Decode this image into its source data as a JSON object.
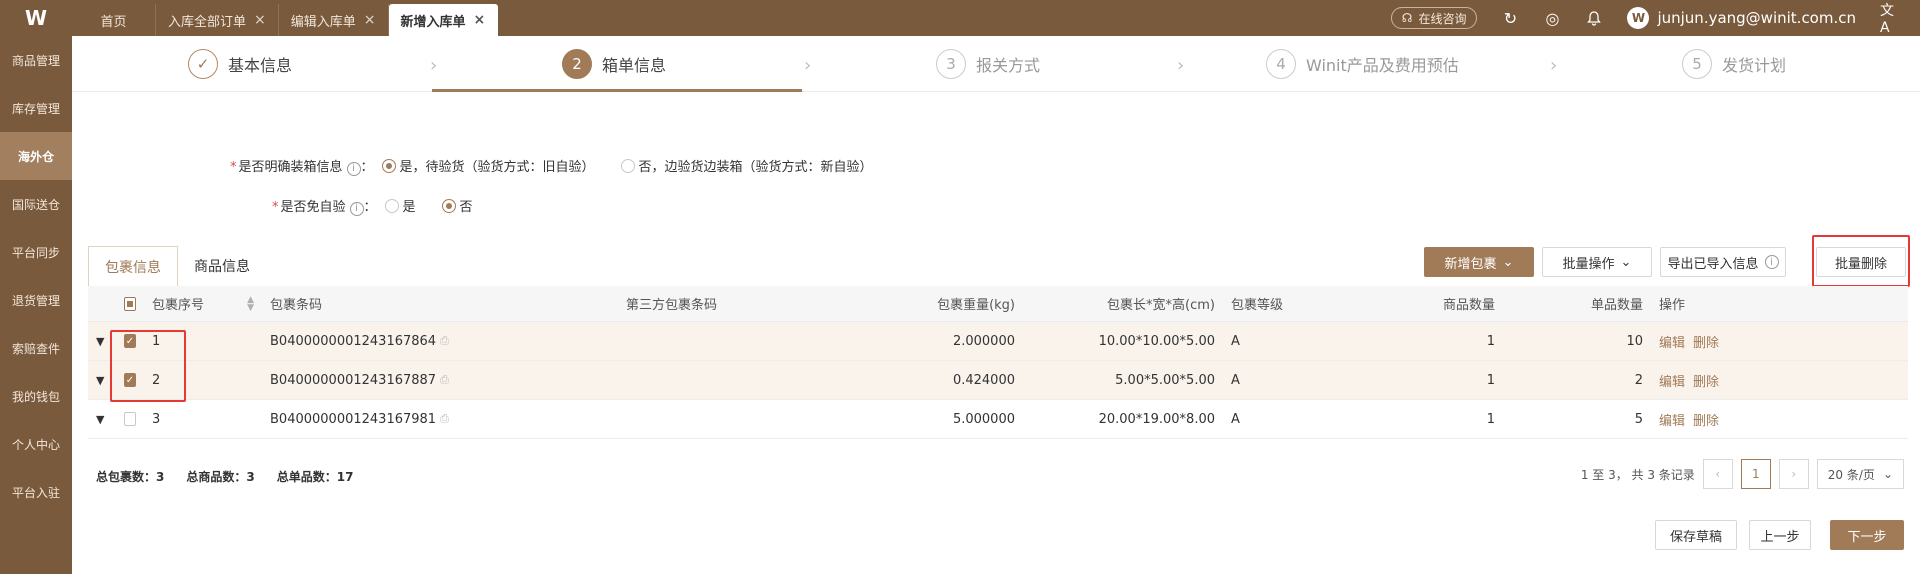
{
  "topbar": {
    "logo": "W",
    "tabs": [
      {
        "label": "首页",
        "closable": false
      },
      {
        "label": "入库全部订单",
        "closable": true
      },
      {
        "label": "编辑入库单",
        "closable": true
      },
      {
        "label": "新增入库单",
        "closable": true,
        "active": true
      }
    ],
    "consult_label": "在线咨询",
    "user_email": "junjun.yang@winit.com.cn"
  },
  "sidebar": {
    "items": [
      "商品管理",
      "库存管理",
      "海外仓",
      "国际送仓",
      "平台同步",
      "退货管理",
      "索赔查件",
      "我的钱包",
      "个人中心",
      "平台入驻"
    ],
    "active": "海外仓"
  },
  "stepper": {
    "steps": [
      {
        "num": "✓",
        "label": "基本信息"
      },
      {
        "num": "2",
        "label": "箱单信息"
      },
      {
        "num": "3",
        "label": "报关方式"
      },
      {
        "num": "4",
        "label": "Winit产品及费用预估"
      },
      {
        "num": "5",
        "label": "发货计划"
      }
    ]
  },
  "form": {
    "q1_label": "是否明确装箱信息",
    "q1_opt1": "是，待验货（验货方式：旧自验）",
    "q1_opt2": "否，边验货边装箱（验货方式：新自验）",
    "q2_label": "是否免自验",
    "q2_opt1": "是",
    "q2_opt2": "否"
  },
  "subtabs": [
    "包裹信息",
    "商品信息"
  ],
  "toolbar": {
    "add_package": "新增包裹",
    "batch_ops": "批量操作",
    "export_imported": "导出已导入信息",
    "batch_delete": "批量删除"
  },
  "table": {
    "headers": {
      "seq": "包裹序号",
      "barcode": "包裹条码",
      "third_barcode": "第三方包裹条码",
      "weight": "包裹重量(kg)",
      "dims": "包裹长*宽*高(cm)",
      "grade": "包裹等级",
      "goods_count": "商品数量",
      "unit_count": "单品数量",
      "ops": "操作"
    },
    "rows": [
      {
        "seq": "1",
        "barcode": "B0400000001243167864",
        "third": "",
        "weight": "2.000000",
        "dims": "10.00*10.00*5.00",
        "grade": "A",
        "goods": "1",
        "units": "10",
        "edit": "编辑",
        "del": "删除",
        "checked": true
      },
      {
        "seq": "2",
        "barcode": "B0400000001243167887",
        "third": "",
        "weight": "0.424000",
        "dims": "5.00*5.00*5.00",
        "grade": "A",
        "goods": "1",
        "units": "2",
        "edit": "编辑",
        "del": "删除",
        "checked": true
      },
      {
        "seq": "3",
        "barcode": "B0400000001243167981",
        "third": "",
        "weight": "5.000000",
        "dims": "20.00*19.00*8.00",
        "grade": "A",
        "goods": "1",
        "units": "5",
        "edit": "编辑",
        "del": "删除",
        "checked": false
      }
    ]
  },
  "summary": {
    "packages_label": "总包裹数：",
    "packages": "3",
    "goods_label": "总商品数：",
    "goods": "3",
    "units_label": "总单品数：",
    "units": "17"
  },
  "pager": {
    "info": "1 至 3， 共 3 条记录",
    "current": "1",
    "page_size": "20 条/页"
  },
  "actions": {
    "save_draft": "保存草稿",
    "prev": "上一步",
    "next": "下一步"
  },
  "colors": {
    "brand": "#7a5a3c",
    "accent": "#a17a57",
    "highlight_box": "#e53935"
  }
}
